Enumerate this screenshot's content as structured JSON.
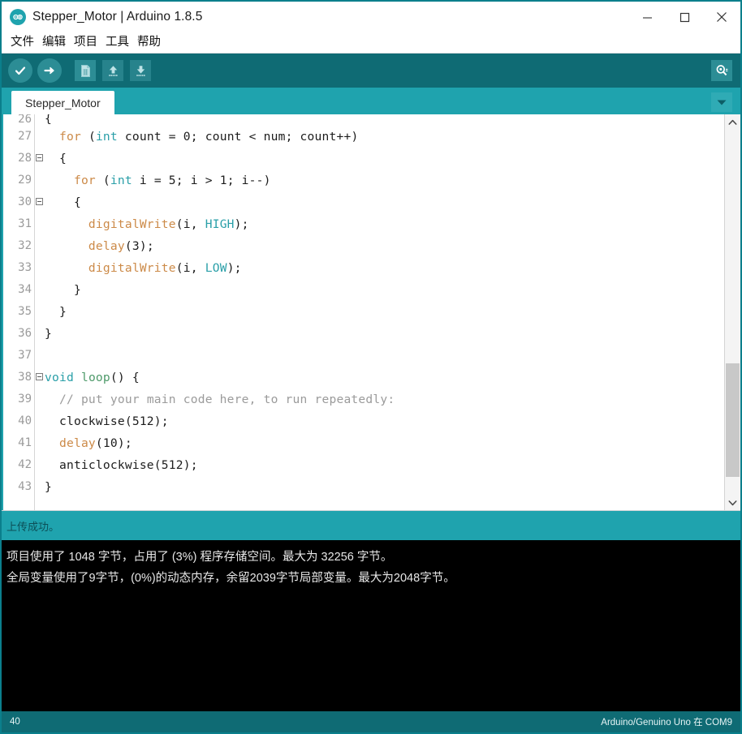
{
  "window": {
    "title": "Stepper_Motor | Arduino 1.8.5",
    "app_icon": "arduino-logo-icon",
    "controls": {
      "minimize": "minimize-icon",
      "maximize": "maximize-icon",
      "close": "close-icon"
    }
  },
  "menu": {
    "items": [
      {
        "label": "文件"
      },
      {
        "label": "编辑"
      },
      {
        "label": "项目"
      },
      {
        "label": "工具"
      },
      {
        "label": "帮助"
      }
    ]
  },
  "toolbar": {
    "verify": "verify-check-icon",
    "upload": "upload-arrow-icon",
    "new": "new-file-icon",
    "open": "open-up-arrow-icon",
    "save": "save-down-arrow-icon",
    "serial_monitor": "serial-monitor-magnifier-icon"
  },
  "tabs": {
    "active": "Stepper_Motor",
    "items": [
      {
        "label": "Stepper_Motor"
      }
    ],
    "menu_arrow": "chevron-down-icon"
  },
  "editor": {
    "lines": [
      {
        "num": "26",
        "fold": true,
        "partial": true,
        "tokens": [
          {
            "t": "{",
            "c": "plain"
          }
        ]
      },
      {
        "num": "27",
        "fold": false,
        "tokens": [
          {
            "t": "  ",
            "c": "plain"
          },
          {
            "t": "for",
            "c": "kw"
          },
          {
            "t": " (",
            "c": "plain"
          },
          {
            "t": "int",
            "c": "type"
          },
          {
            "t": " count = 0; count < num; count++)",
            "c": "plain"
          }
        ]
      },
      {
        "num": "28",
        "fold": true,
        "tokens": [
          {
            "t": "  {",
            "c": "plain"
          }
        ]
      },
      {
        "num": "29",
        "fold": false,
        "tokens": [
          {
            "t": "    ",
            "c": "plain"
          },
          {
            "t": "for",
            "c": "kw"
          },
          {
            "t": " (",
            "c": "plain"
          },
          {
            "t": "int",
            "c": "type"
          },
          {
            "t": " i = 5; i > 1; i--)",
            "c": "plain"
          }
        ]
      },
      {
        "num": "30",
        "fold": true,
        "tokens": [
          {
            "t": "    {",
            "c": "plain"
          }
        ]
      },
      {
        "num": "31",
        "fold": false,
        "tokens": [
          {
            "t": "      ",
            "c": "plain"
          },
          {
            "t": "digitalWrite",
            "c": "kw"
          },
          {
            "t": "(i, ",
            "c": "plain"
          },
          {
            "t": "HIGH",
            "c": "type"
          },
          {
            "t": ");",
            "c": "plain"
          }
        ]
      },
      {
        "num": "32",
        "fold": false,
        "tokens": [
          {
            "t": "      ",
            "c": "plain"
          },
          {
            "t": "delay",
            "c": "kw"
          },
          {
            "t": "(3);",
            "c": "plain"
          }
        ]
      },
      {
        "num": "33",
        "fold": false,
        "tokens": [
          {
            "t": "      ",
            "c": "plain"
          },
          {
            "t": "digitalWrite",
            "c": "kw"
          },
          {
            "t": "(i, ",
            "c": "plain"
          },
          {
            "t": "LOW",
            "c": "type"
          },
          {
            "t": ");",
            "c": "plain"
          }
        ]
      },
      {
        "num": "34",
        "fold": false,
        "tokens": [
          {
            "t": "    }",
            "c": "plain"
          }
        ]
      },
      {
        "num": "35",
        "fold": false,
        "tokens": [
          {
            "t": "  }",
            "c": "plain"
          }
        ]
      },
      {
        "num": "36",
        "fold": false,
        "tokens": [
          {
            "t": "}",
            "c": "plain"
          }
        ]
      },
      {
        "num": "37",
        "fold": false,
        "tokens": [
          {
            "t": "",
            "c": "plain"
          }
        ]
      },
      {
        "num": "38",
        "fold": true,
        "tokens": [
          {
            "t": "void",
            "c": "void"
          },
          {
            "t": " ",
            "c": "plain"
          },
          {
            "t": "loop",
            "c": "fn"
          },
          {
            "t": "() {",
            "c": "plain"
          }
        ]
      },
      {
        "num": "39",
        "fold": false,
        "tokens": [
          {
            "t": "  ",
            "c": "plain"
          },
          {
            "t": "// put your main code here, to run repeatedly:",
            "c": "comment"
          }
        ]
      },
      {
        "num": "40",
        "fold": false,
        "tokens": [
          {
            "t": "  clockwise(512);",
            "c": "plain"
          }
        ]
      },
      {
        "num": "41",
        "fold": false,
        "tokens": [
          {
            "t": "  ",
            "c": "plain"
          },
          {
            "t": "delay",
            "c": "kw"
          },
          {
            "t": "(10);",
            "c": "plain"
          }
        ]
      },
      {
        "num": "42",
        "fold": false,
        "tokens": [
          {
            "t": "  anticlockwise(512);",
            "c": "plain"
          }
        ]
      },
      {
        "num": "43",
        "fold": false,
        "tokens": [
          {
            "t": "}",
            "c": "plain"
          }
        ]
      }
    ],
    "scrollbar": {
      "up_arrow": "chevron-up-icon",
      "down_arrow": "chevron-down-icon"
    }
  },
  "status_message": "上传成功。",
  "console": {
    "lines": [
      "项目使用了 1048 字节，占用了 (3%) 程序存储空间。最大为 32256 字节。",
      "全局变量使用了9字节，(0%)的动态内存，余留2039字节局部变量。最大为2048字节。"
    ]
  },
  "statusbar": {
    "line_number": "40",
    "board": "Arduino/Genuino Uno 在 COM9"
  },
  "colors": {
    "teal_dark": "#0f6b74",
    "teal": "#1fa3ae",
    "console_bg": "#000000",
    "keyword": "#cc8a48",
    "type": "#2a9fa8",
    "comment": "#9b9b9b"
  }
}
